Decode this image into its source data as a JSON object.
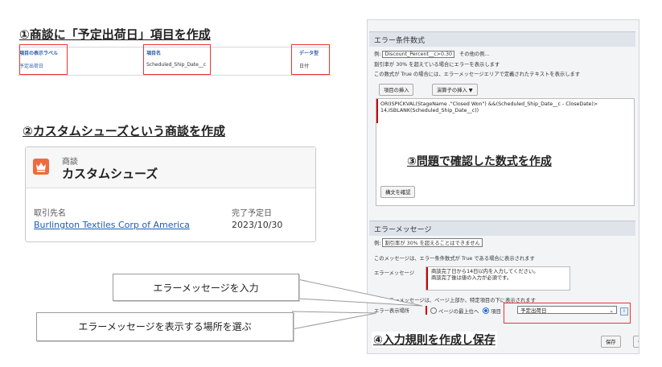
{
  "step1": {
    "title": "①商談に「予定出荷日」項目を作成",
    "headers": [
      "項目の表示ラベル",
      "項目名",
      "データ型"
    ],
    "row": [
      "予定出荷日",
      "Scheduled_Ship_Date__c",
      "日付"
    ]
  },
  "step2": {
    "title": "②カスタムシューズという商談を作成",
    "kicker": "商談",
    "record_name": "カスタムシューズ",
    "account_label": "取引先名",
    "account_value": "Burlington Textiles Corp of America",
    "close_label": "完了予定日",
    "close_value": "2023/10/30"
  },
  "panel": {
    "formula_section": "エラー条件数式",
    "example_prefix": "例:",
    "example_value": "Discount_Percent__c>0.30",
    "example_more": "その他の例...",
    "example_desc": "割引率が 30% を超えている場合にエラーを表示します",
    "true_desc": "この数式が True の場合には、エラーメッセージエリアで定義されたテキストを表示します",
    "insert_field": "項目の挿入",
    "insert_operator": "演算子の挿入 ▼",
    "formula_text": "OR(ISPICKVAL(StageName ,\"Closed Won\") &&(Scheduled_Ship_Date__c - CloseDate)>\n14,ISBLANK(Scheduled_Ship_Date__c))",
    "check_syntax": "構文を確認",
    "message_section": "エラーメッセージ",
    "msg_example_prefix": "例:",
    "msg_example_value": "割引率が 30% を超えることはできません",
    "msg_desc": "このメッセージは、エラー条件数式が True である場合に表示されます",
    "error_message_label": "エラーメッセージ",
    "error_message_text": "商談完了日から14日以内を入力してください。\n商談完了後は値の入力が必須です。",
    "location_desc": "このエラーメッセージは、ページ上部か、特定項目の下に表示されます",
    "location_label": "エラー表示場所",
    "opt_top": "ページの最上位へ",
    "opt_field": "項目",
    "field_select": "予定出荷日",
    "save": "保存",
    "save_new": "保存"
  },
  "step3": {
    "title": "③問題で確認した数式を作成"
  },
  "step4": {
    "title": "④入力規則を作成し保存"
  },
  "callouts": {
    "enter_message": "エラーメッセージを入力",
    "choose_location": "エラーメッセージを表示する場所を選ぶ"
  }
}
